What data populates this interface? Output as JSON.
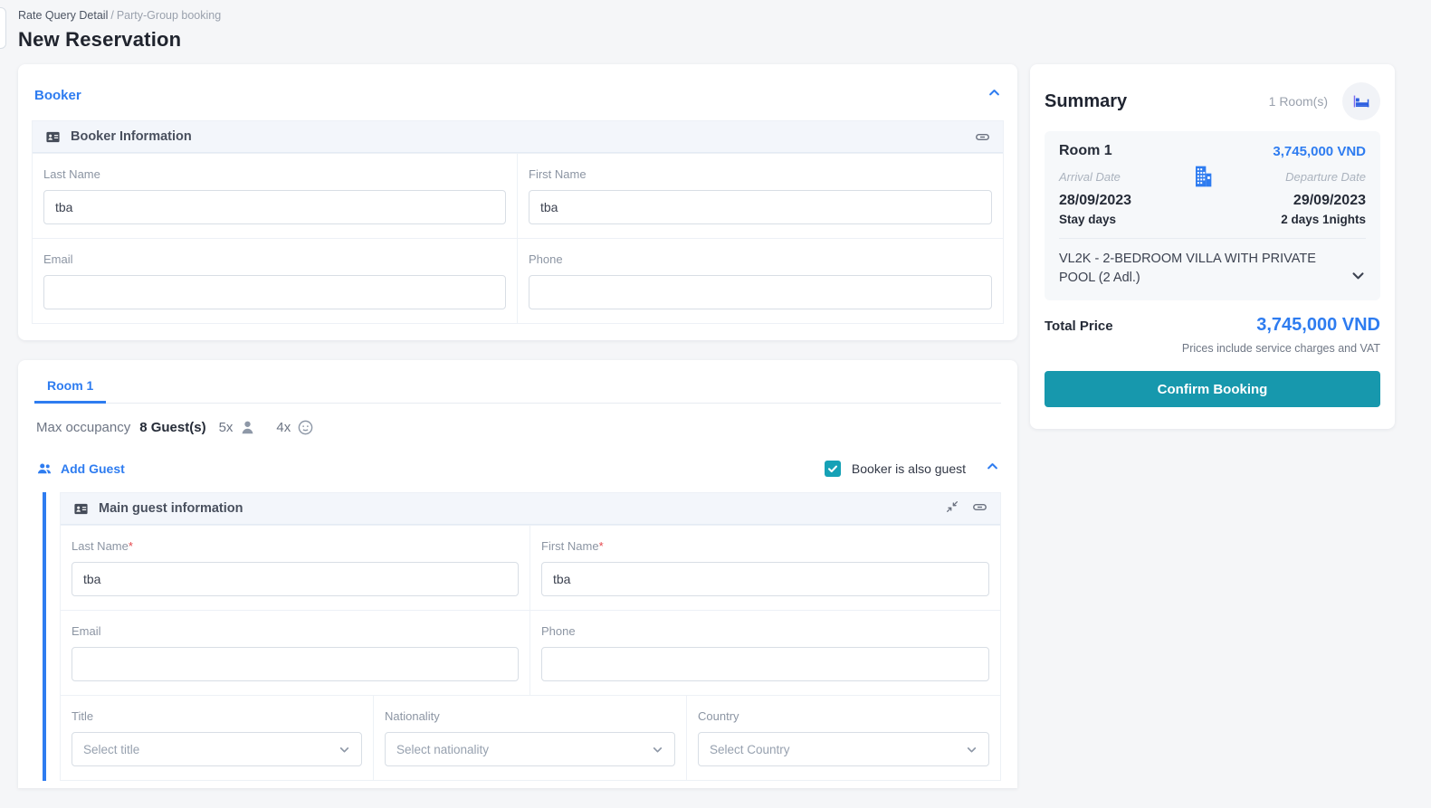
{
  "breadcrumb": {
    "primary": "Rate Query Detail",
    "separator": "/",
    "secondary": "Party-Group booking"
  },
  "page_title": "New Reservation",
  "booker": {
    "section_title": "Booker",
    "card_title": "Booker Information",
    "fields": {
      "last_name": {
        "label": "Last Name",
        "value": "tba"
      },
      "first_name": {
        "label": "First Name",
        "value": "tba"
      },
      "email": {
        "label": "Email",
        "value": ""
      },
      "phone": {
        "label": "Phone",
        "value": ""
      }
    }
  },
  "room_section": {
    "tab_label": "Room 1",
    "max_occupancy_label": "Max occupancy",
    "max_occupancy_value": "8 Guest(s)",
    "adults_multiplier": "5x",
    "children_multiplier": "4x",
    "add_guest_label": "Add Guest",
    "booker_is_guest_label": "Booker is also guest",
    "guest_card_title": "Main guest information",
    "required_mark": "*",
    "fields": {
      "last_name": {
        "label": "Last Name",
        "value": "tba"
      },
      "first_name": {
        "label": "First Name",
        "value": "tba"
      },
      "email": {
        "label": "Email",
        "value": ""
      },
      "phone": {
        "label": "Phone",
        "value": ""
      },
      "title": {
        "label": "Title",
        "placeholder": "Select title"
      },
      "nationality": {
        "label": "Nationality",
        "placeholder": "Select nationality"
      },
      "country": {
        "label": "Country",
        "placeholder": "Select Country"
      }
    }
  },
  "summary": {
    "title": "Summary",
    "rooms_count": "1 Room(s)",
    "room": {
      "name": "Room 1",
      "price": "3,745,000 VND",
      "arrival_label": "Arrival Date",
      "arrival_date": "28/09/2023",
      "departure_label": "Departure Date",
      "departure_date": "29/09/2023",
      "stay_label": "Stay days",
      "stay_value": "2 days 1nights",
      "room_type": "VL2K - 2-BEDROOM VILLA WITH PRIVATE POOL (2 Adl.)"
    },
    "total_label": "Total Price",
    "total_price": "3,745,000 VND",
    "vat_note": "Prices include service charges and VAT",
    "confirm_label": "Confirm Booking"
  },
  "icons": [
    "id-card-icon",
    "link-icon",
    "chevron-up-icon",
    "chevron-down-icon",
    "adult-icon",
    "child-icon",
    "add-guest-people-icon",
    "check-icon",
    "merge-icon",
    "bed-icon",
    "building-icon"
  ],
  "colors": {
    "accent_blue": "#2e7cf0",
    "teal": "#1798ad",
    "checkbox_teal": "#16a1b6",
    "required_red": "#e5484d",
    "header_band": "#f3f6fb",
    "page_bg": "#f5f6f8"
  }
}
